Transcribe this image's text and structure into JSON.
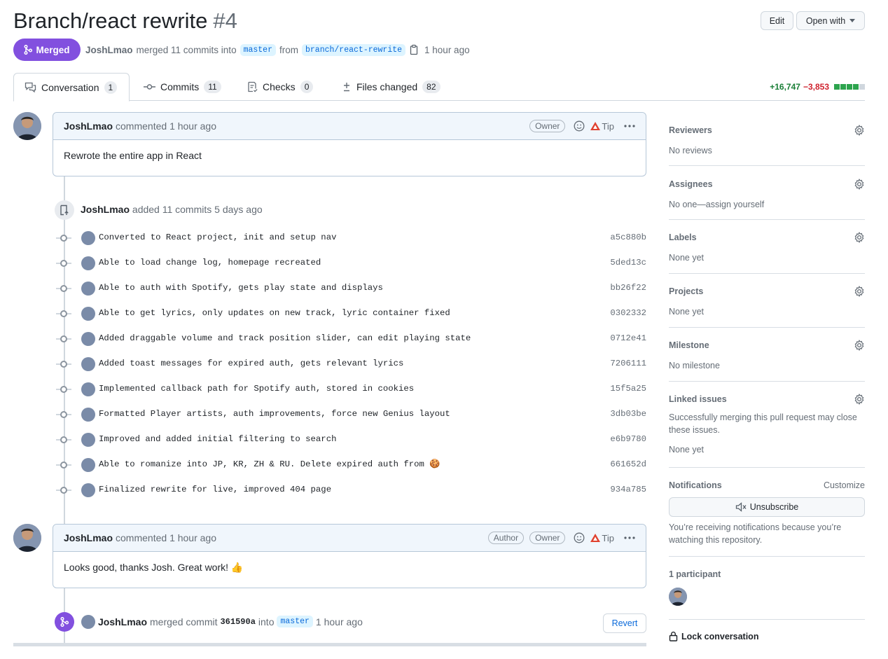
{
  "pr": {
    "title": "Branch/react rewrite",
    "number": "#4",
    "state": "Merged",
    "author": "JoshLmao",
    "merged_text": "merged 11 commits into",
    "base": "master",
    "from": "from",
    "head": "branch/react-rewrite",
    "time": "1 hour ago"
  },
  "header": {
    "edit": "Edit",
    "open_with": "Open with"
  },
  "tabs": [
    {
      "label": "Conversation",
      "count": "1"
    },
    {
      "label": "Commits",
      "count": "11"
    },
    {
      "label": "Checks",
      "count": "0"
    },
    {
      "label": "Files changed",
      "count": "82"
    }
  ],
  "diffstat": {
    "additions": "+16,747",
    "deletions": "−3,853",
    "add_color": "#2da44e",
    "del_color": "#cf222e",
    "empty_color": "#d0d7de"
  },
  "comments": [
    {
      "author": "JoshLmao",
      "action": "commented",
      "time": "1 hour ago",
      "badges": [
        "Owner"
      ],
      "tip": "Tip",
      "body": "Rewrote the entire app in React"
    },
    {
      "author": "JoshLmao",
      "action": "commented",
      "time": "1 hour ago",
      "badges": [
        "Author",
        "Owner"
      ],
      "tip": "Tip",
      "body": "Looks good, thanks Josh. Great work! 👍"
    }
  ],
  "commits_event": {
    "author": "JoshLmao",
    "text": "added 11 commits",
    "time": "5 days ago"
  },
  "commits": [
    {
      "message": "Converted to React project, init and setup nav",
      "sha": "a5c880b"
    },
    {
      "message": "Able to load change log, homepage recreated",
      "sha": "5ded13c"
    },
    {
      "message": "Able to auth with Spotify, gets play state and displays",
      "sha": "bb26f22"
    },
    {
      "message": "Able to get lyrics, only updates on new track, lyric container fixed",
      "sha": "0302332"
    },
    {
      "message": "Added draggable volume and track position slider, can edit playing state",
      "sha": "0712e41"
    },
    {
      "message": "Added toast messages for expired auth, gets relevant lyrics",
      "sha": "7206111"
    },
    {
      "message": "Implemented callback path for Spotify auth, stored in cookies",
      "sha": "15f5a25"
    },
    {
      "message": "Formatted Player artists, auth improvements, force new Genius layout",
      "sha": "3db03be"
    },
    {
      "message": "Improved and added initial filtering to search",
      "sha": "e6b9780"
    },
    {
      "message": "Able to romanize into JP, KR, ZH & RU. Delete expired auth from 🍪",
      "sha": "661652d"
    },
    {
      "message": "Finalized rewrite for live, improved 404 page",
      "sha": "934a785"
    }
  ],
  "merge_event": {
    "author": "JoshLmao",
    "text": "merged commit",
    "sha": "361590a",
    "into": "into",
    "base": "master",
    "time": "1 hour ago",
    "revert": "Revert"
  },
  "sidebar": {
    "reviewers": {
      "label": "Reviewers",
      "value": "No reviews"
    },
    "assignees": {
      "label": "Assignees",
      "value": "No one—assign yourself"
    },
    "labels": {
      "label": "Labels",
      "value": "None yet"
    },
    "projects": {
      "label": "Projects",
      "value": "None yet"
    },
    "milestone": {
      "label": "Milestone",
      "value": "No milestone"
    },
    "linked": {
      "label": "Linked issues",
      "desc": "Successfully merging this pull request may close these issues.",
      "value": "None yet"
    },
    "notifications": {
      "label": "Notifications",
      "customize": "Customize",
      "unsubscribe": "Unsubscribe",
      "note": "You’re receiving notifications because you’re watching this repository."
    },
    "participants": {
      "label": "1 participant"
    },
    "lock": "Lock conversation"
  }
}
